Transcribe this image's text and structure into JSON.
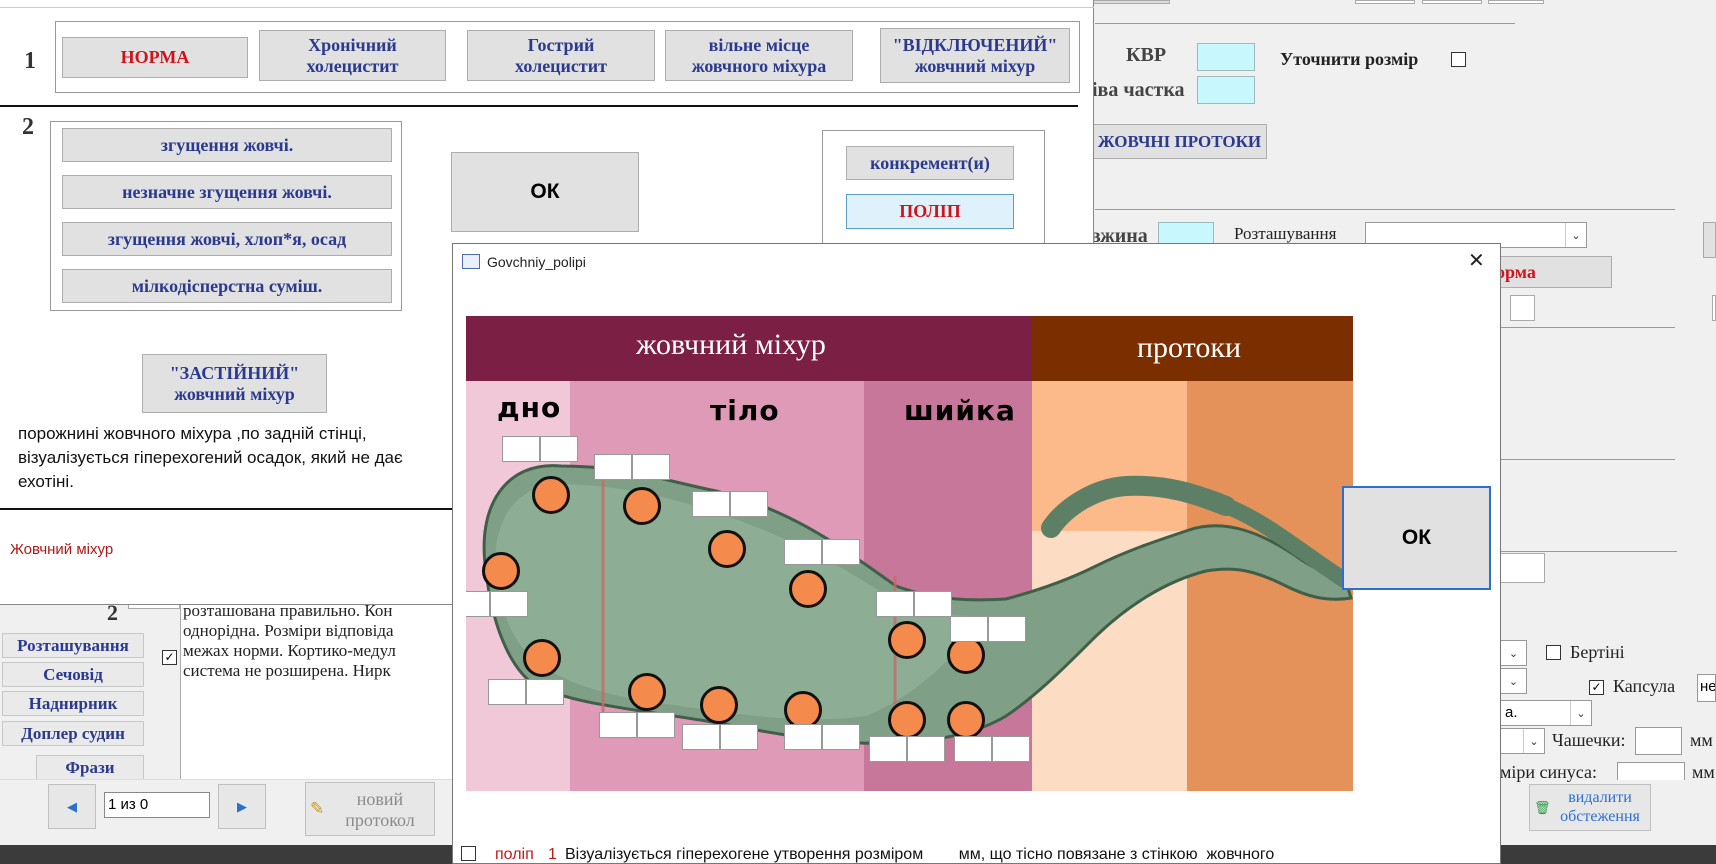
{
  "background_form": {
    "kvr_label": "КВР",
    "part_label": "іва частка",
    "clarify_label": "Уточнити розмір",
    "ducts_button": "ЖОВЧНІ ПРОТОКИ",
    "length_label": "вжина",
    "location_label": "Розташування",
    "norma_button": "орма",
    "bertini_label": "Бертіні",
    "kapsula_label": "Капсула",
    "kapsula_value": "не",
    "combo_value_small": "а.",
    "chashechky_label": "Чашечки:",
    "mm1": "мм",
    "sinus_label": "міри синуса:",
    "mm2": "мм",
    "delete_button": "видалити\nобстеження",
    "left_text": "розташована правильно. Кон\nоднорідна. Розміри відповіда\nмежах норми. Кортико-медул\nсистема не розширена. Нирк",
    "row_number": "2",
    "side_buttons": [
      "Розташування",
      "Сечовід",
      "Наднирник",
      "Доплер судин",
      "Фрази"
    ],
    "nav_record": "1 из 0",
    "new_protocol": "новий\nпротокол"
  },
  "gallbladder_window": {
    "section1_number": "1",
    "section2_number": "2",
    "top_buttons": [
      "НОРМА",
      "Хронічний\nхолецистит",
      "Гострий\nхолецистит",
      "вільне місце\nжовчного міхура",
      "\"ВІДКЛЮЧЕНИЙ\"\nжовчний міхур"
    ],
    "bile_buttons": [
      "згущення жовчі.",
      "незначне згущення жовчі.",
      "згущення жовчі, хлоп*я, осад",
      "мілкодісперстна суміш."
    ],
    "ok_label": "ОК",
    "stasis_button": "\"ЗАСТІЙНИЙ\"\nжовчний міхур",
    "right_buttons": [
      "конкремент(и)",
      "ПОЛІП"
    ],
    "description": "порожнині жовчного міхура ,по задній стінці,\nвізуалізується гіперехогений осадок, який не дає\nехотіні.",
    "footer_label": "Жовчний міхур"
  },
  "polyp_window": {
    "title": "Govchniy_polipi",
    "close_glyph": "✕",
    "header_gallbladder": "жовчний міхур",
    "header_ducts": "протоки",
    "zone_fundus": "дно",
    "zone_body": "тіло",
    "zone_neck": "шийка",
    "ok_label": "ОК",
    "bottom_text_prefix": "поліп",
    "bottom_text_number": "1",
    "bottom_text": "Візуалізується гіперехогене утворення розміром        мм, що тісно повязане з стінкою  жовчного",
    "colors": {
      "header_gb": "#7b1f45",
      "header_ducts": "#7b2f00",
      "fundus": "#f0c8d8",
      "body": "#df9ab8",
      "neck": "#c7789a",
      "duct1": "#fcb98a",
      "duct2": "#e4915a",
      "dot": "#f48a4c"
    }
  }
}
